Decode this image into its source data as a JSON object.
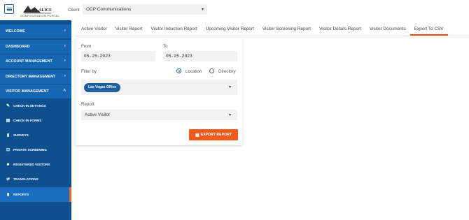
{
  "header": {
    "logo_sub": "CONFIGURATION PORTAL",
    "client_label": "Client",
    "client_value": "OCP Communications"
  },
  "sidebar": {
    "items": [
      {
        "label": "WELCOME"
      },
      {
        "label": "DASHBOARD"
      },
      {
        "label": "ACCOUNT MANAGEMENT"
      },
      {
        "label": "DIRECTORY MANAGEMENT"
      },
      {
        "label": "VISITOR MANAGEMENT"
      }
    ],
    "sub_items": [
      {
        "label": "CHECK-IN SETTINGS",
        "icon": "edit-icon"
      },
      {
        "label": "CHECK-IN FORMS",
        "icon": "form-icon"
      },
      {
        "label": "SURVEYS",
        "icon": "document-icon"
      },
      {
        "label": "PRIVATE SCREENING",
        "icon": "lock-icon"
      },
      {
        "label": "REGISTERED VISITORS",
        "icon": "users-icon"
      },
      {
        "label": "TRANSLATIONS",
        "icon": "translate-icon"
      },
      {
        "label": "REPORTS",
        "icon": "document-icon"
      }
    ]
  },
  "tabs": [
    {
      "label": "Active Visitor"
    },
    {
      "label": "Visitor Report"
    },
    {
      "label": "Visitor Induction Report"
    },
    {
      "label": "Upcoming Visitor Report"
    },
    {
      "label": "Visitor Screening Report"
    },
    {
      "label": "Visitor Details Report"
    },
    {
      "label": "Visitor Documents"
    },
    {
      "label": "Export To CSV"
    }
  ],
  "form": {
    "from_label": "From",
    "from_value": "05-25-2023",
    "to_label": "To",
    "to_value": "05-25-2023",
    "filter_label": "Filter by",
    "radio_location": "Location",
    "radio_directory": "Directory",
    "chip": "Las Vegas Office",
    "report_label": "Report",
    "report_value": "Active Visitor",
    "export_label": "EXPORT REPORT"
  },
  "colors": {
    "sidebar": "#0e4f8e",
    "accent": "#ef5b1e",
    "chip": "#1f5fa0"
  }
}
